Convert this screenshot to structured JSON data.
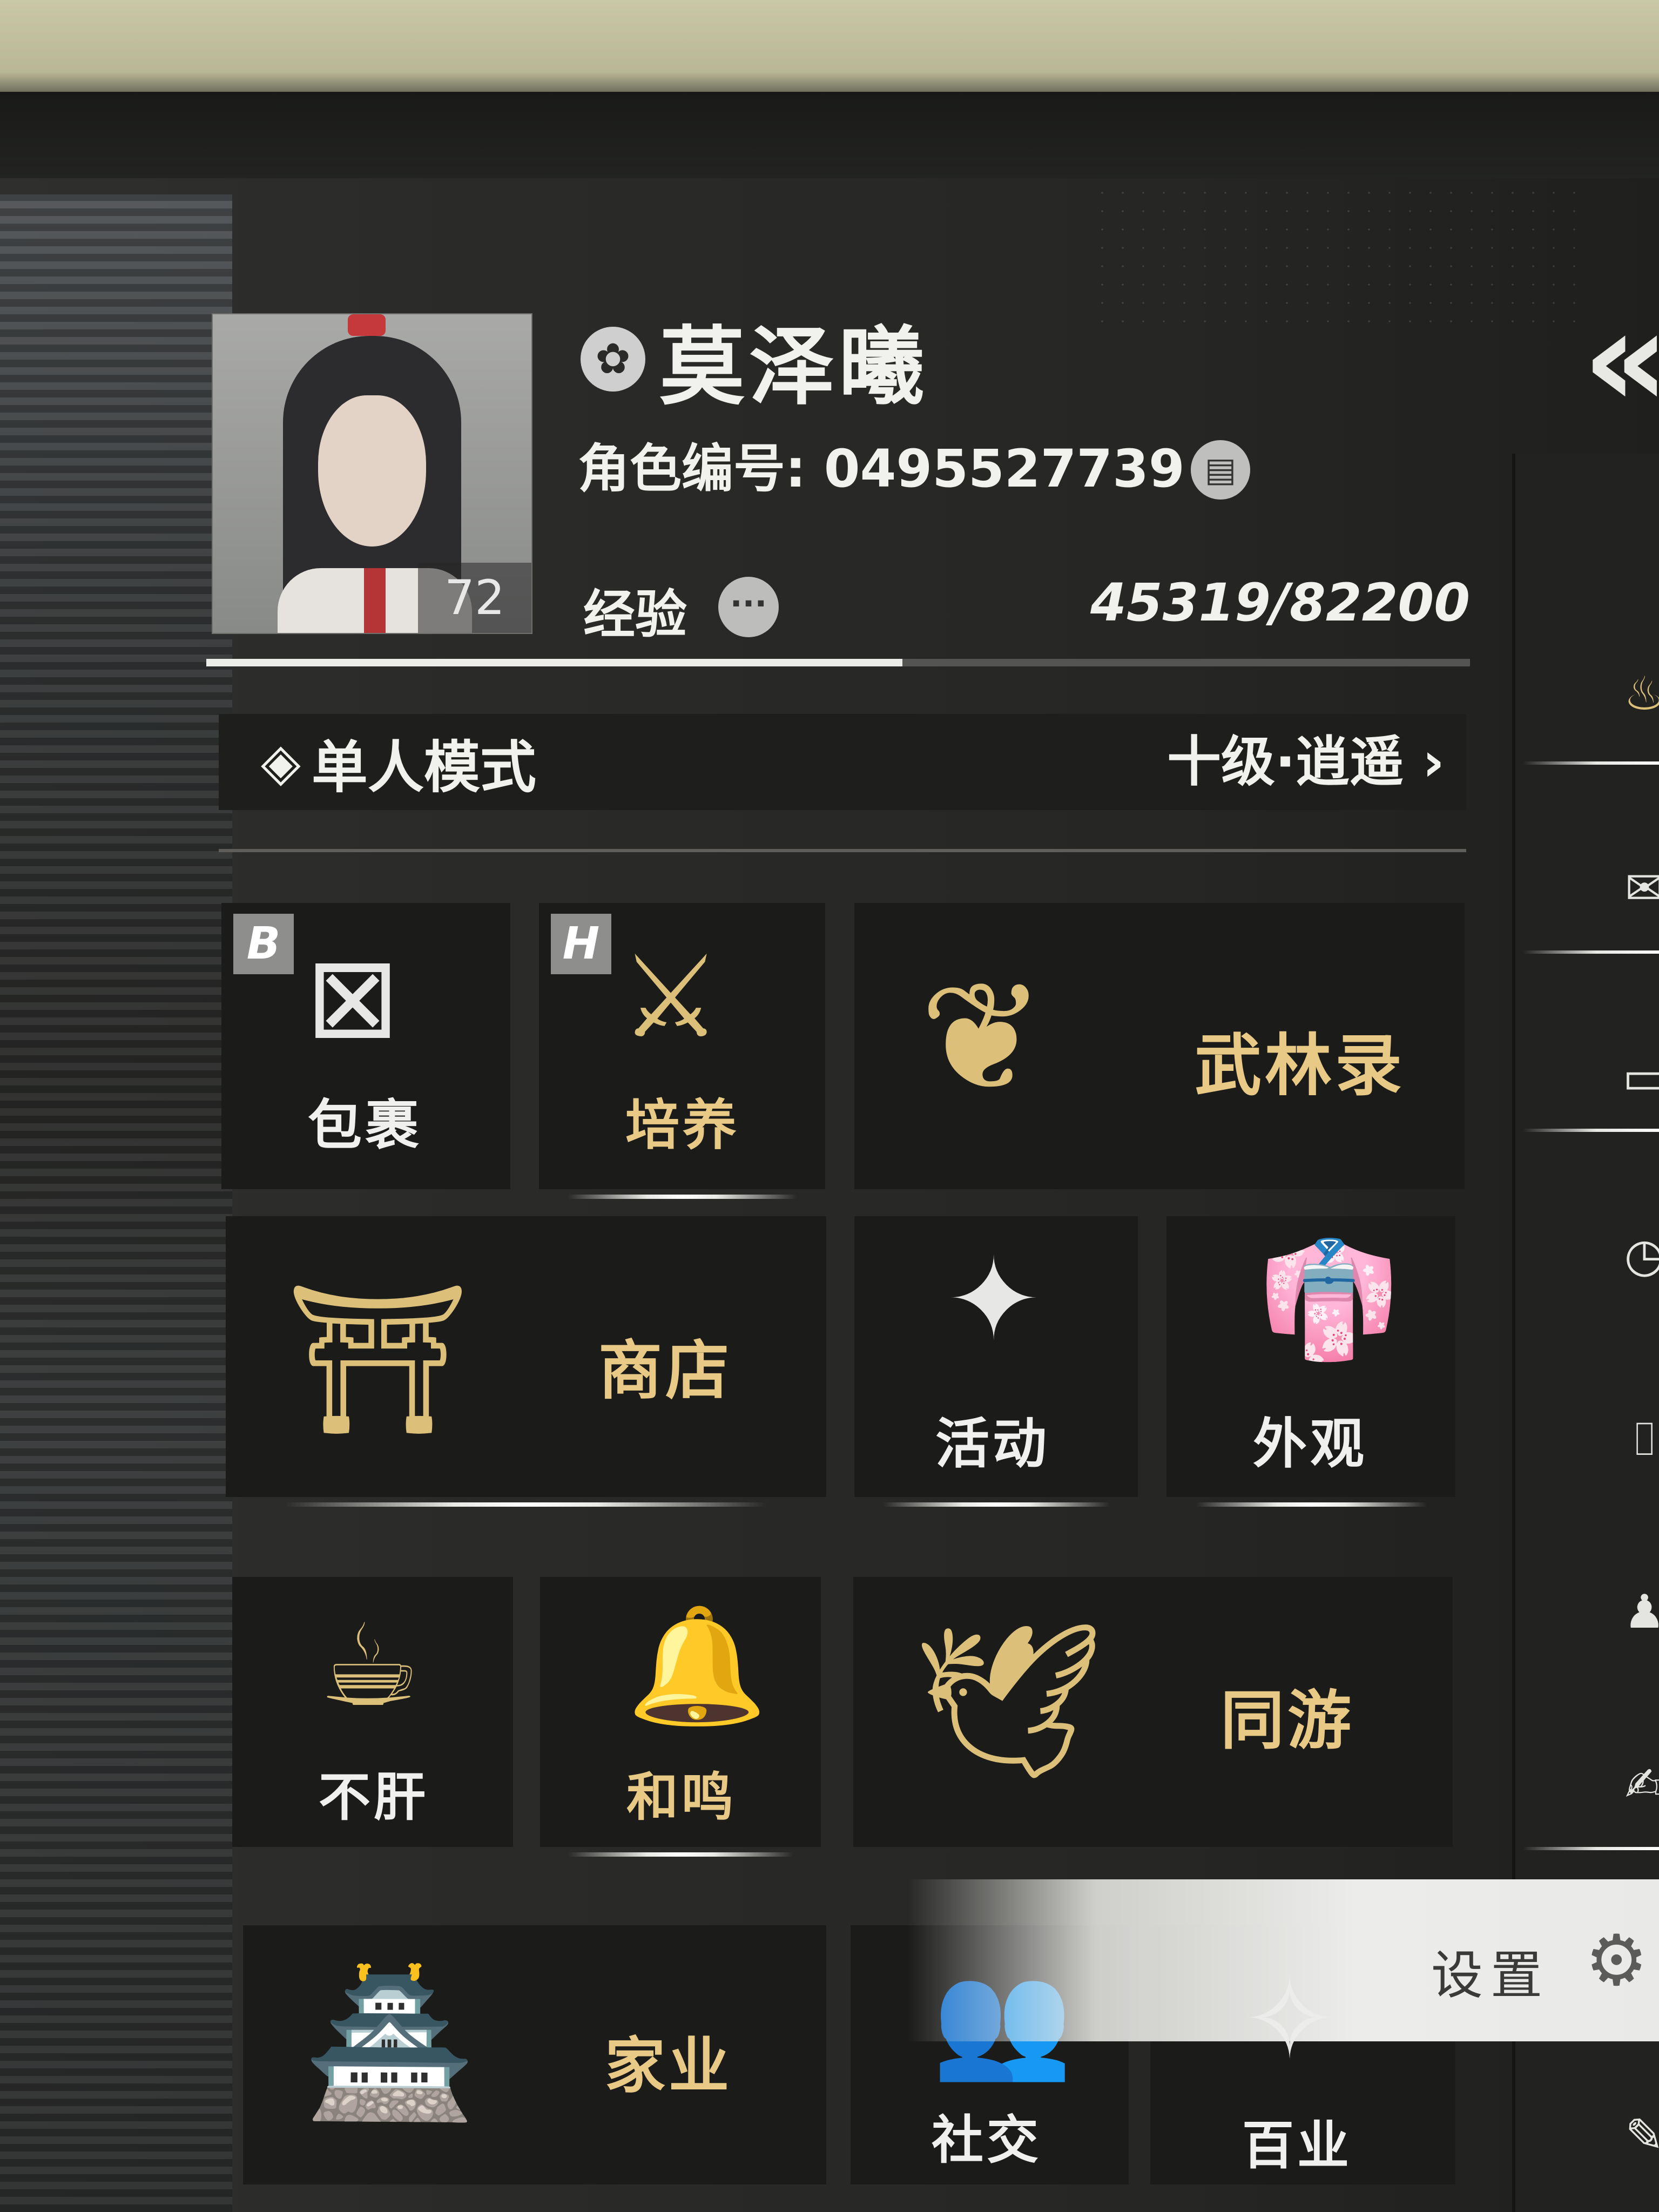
{
  "player": {
    "name": "莫泽曦",
    "id_label": "角色编号: 0495527739",
    "level": "72",
    "exp_label": "经验",
    "exp_value": "45319/82200",
    "exp_progress": 0.551
  },
  "mode": {
    "label": "单人模式",
    "rank": "十级·逍遥",
    "chevron": "›"
  },
  "tiles": {
    "bag": {
      "label": "包裹",
      "key": "B"
    },
    "cultivate": {
      "label": "培养",
      "key": "H"
    },
    "wulin": {
      "label": "武林录"
    },
    "shop": {
      "label": "商店"
    },
    "activity": {
      "label": "活动"
    },
    "appearance": {
      "label": "外观"
    },
    "buggan": {
      "label": "不肝"
    },
    "hemin": {
      "label": "和鸣"
    },
    "tongyou": {
      "label": "同游"
    },
    "family": {
      "label": "家业"
    },
    "social": {
      "label": "社交"
    },
    "baiye": {
      "label": "百业"
    }
  },
  "settings": {
    "label": "设置"
  },
  "icons": {
    "school": "school-emblem-icon",
    "copy": "copy-icon",
    "more": "more-icon",
    "mode": "mode-switch-icon",
    "back": "double-chevron-left-icon",
    "settings": "gear-icon"
  },
  "colors": {
    "gold": "#e8c985",
    "tile_bg": "#1b1b1a",
    "text_light": "#f1f1ee"
  }
}
